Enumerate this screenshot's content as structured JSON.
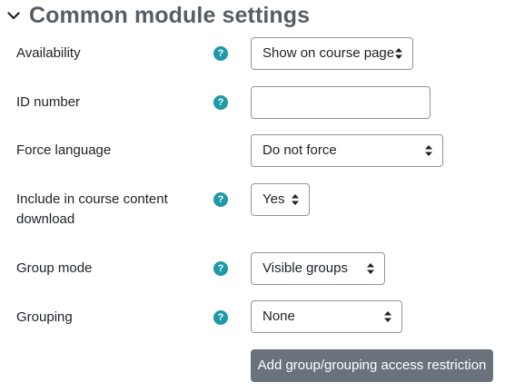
{
  "section": {
    "title": "Common module settings"
  },
  "availability": {
    "label": "Availability",
    "value": "Show on course page"
  },
  "idnumber": {
    "label": "ID number",
    "value": ""
  },
  "forcelanguage": {
    "label": "Force language",
    "value": "Do not force"
  },
  "download": {
    "label_line1": "Include in course content",
    "label_line2": "download",
    "value": "Yes"
  },
  "groupmode": {
    "label": "Group mode",
    "value": "Visible groups"
  },
  "grouping": {
    "label": "Grouping",
    "value": "None"
  },
  "restriction_button": {
    "label": "Add group/grouping access restriction"
  },
  "help_icon_glyph": "?",
  "colors": {
    "help_icon": "#1d99a8",
    "button_bg": "#6a737b",
    "title": "#575d63"
  }
}
